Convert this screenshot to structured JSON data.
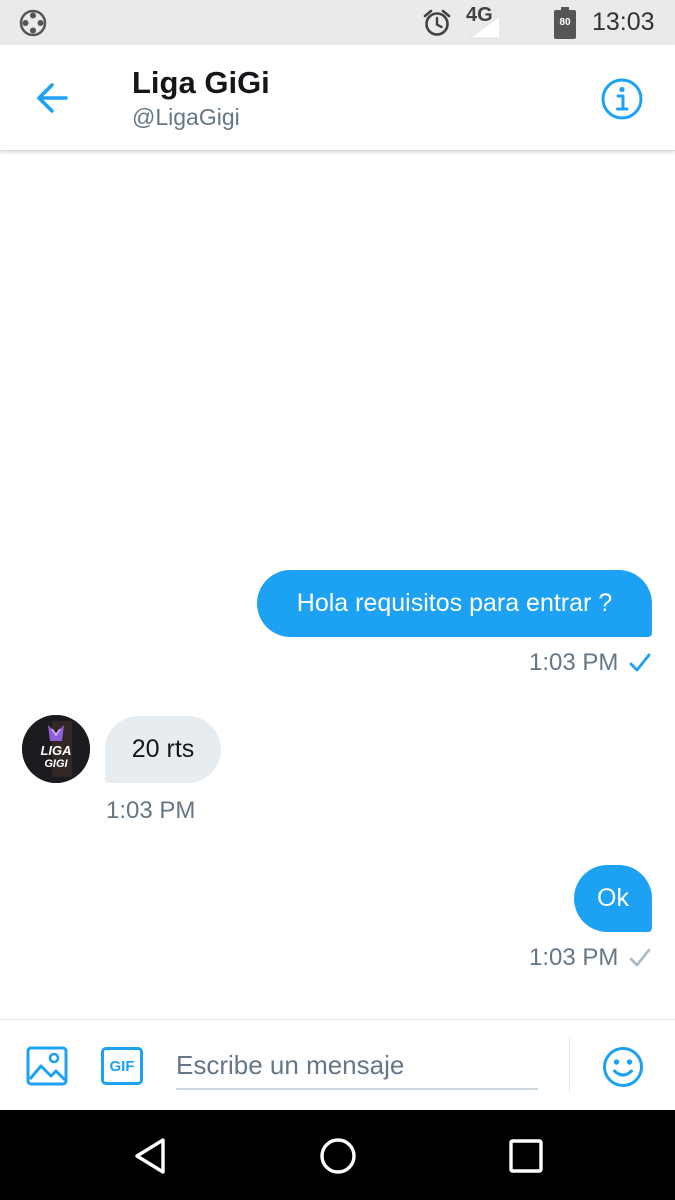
{
  "status_bar": {
    "network": "4G",
    "battery": "80",
    "time": "13:03"
  },
  "header": {
    "name": "Liga GiGi",
    "handle": "@LigaGigi"
  },
  "messages": [
    {
      "direction": "outgoing",
      "text": "Hola requisitos para entrar ?",
      "time": "1:03 PM",
      "status": "read"
    },
    {
      "direction": "incoming",
      "text": "20 rts",
      "time": "1:03 PM"
    },
    {
      "direction": "outgoing",
      "text": "Ok",
      "time": "1:03 PM",
      "status": "sent"
    }
  ],
  "composer": {
    "placeholder": "Escribe un mensaje",
    "gif_label": "GIF"
  },
  "avatar": {
    "text": "LIGA GIGI"
  },
  "colors": {
    "accent": "#1da1f2",
    "incoming_bubble": "#e6ecf0",
    "read_check": "#1da1f2",
    "sent_check": "#aab8c2"
  },
  "icons": {
    "status_left": "app-notification-icon",
    "alarm": "alarm-icon",
    "network": "signal-4g-icon",
    "battery": "battery-icon",
    "back": "arrow-left-icon",
    "info": "info-icon",
    "media": "image-icon",
    "gif": "gif-icon",
    "emoji": "emoji-icon",
    "nav_back": "nav-back-icon",
    "nav_home": "nav-home-icon",
    "nav_recent": "nav-recent-icon"
  }
}
